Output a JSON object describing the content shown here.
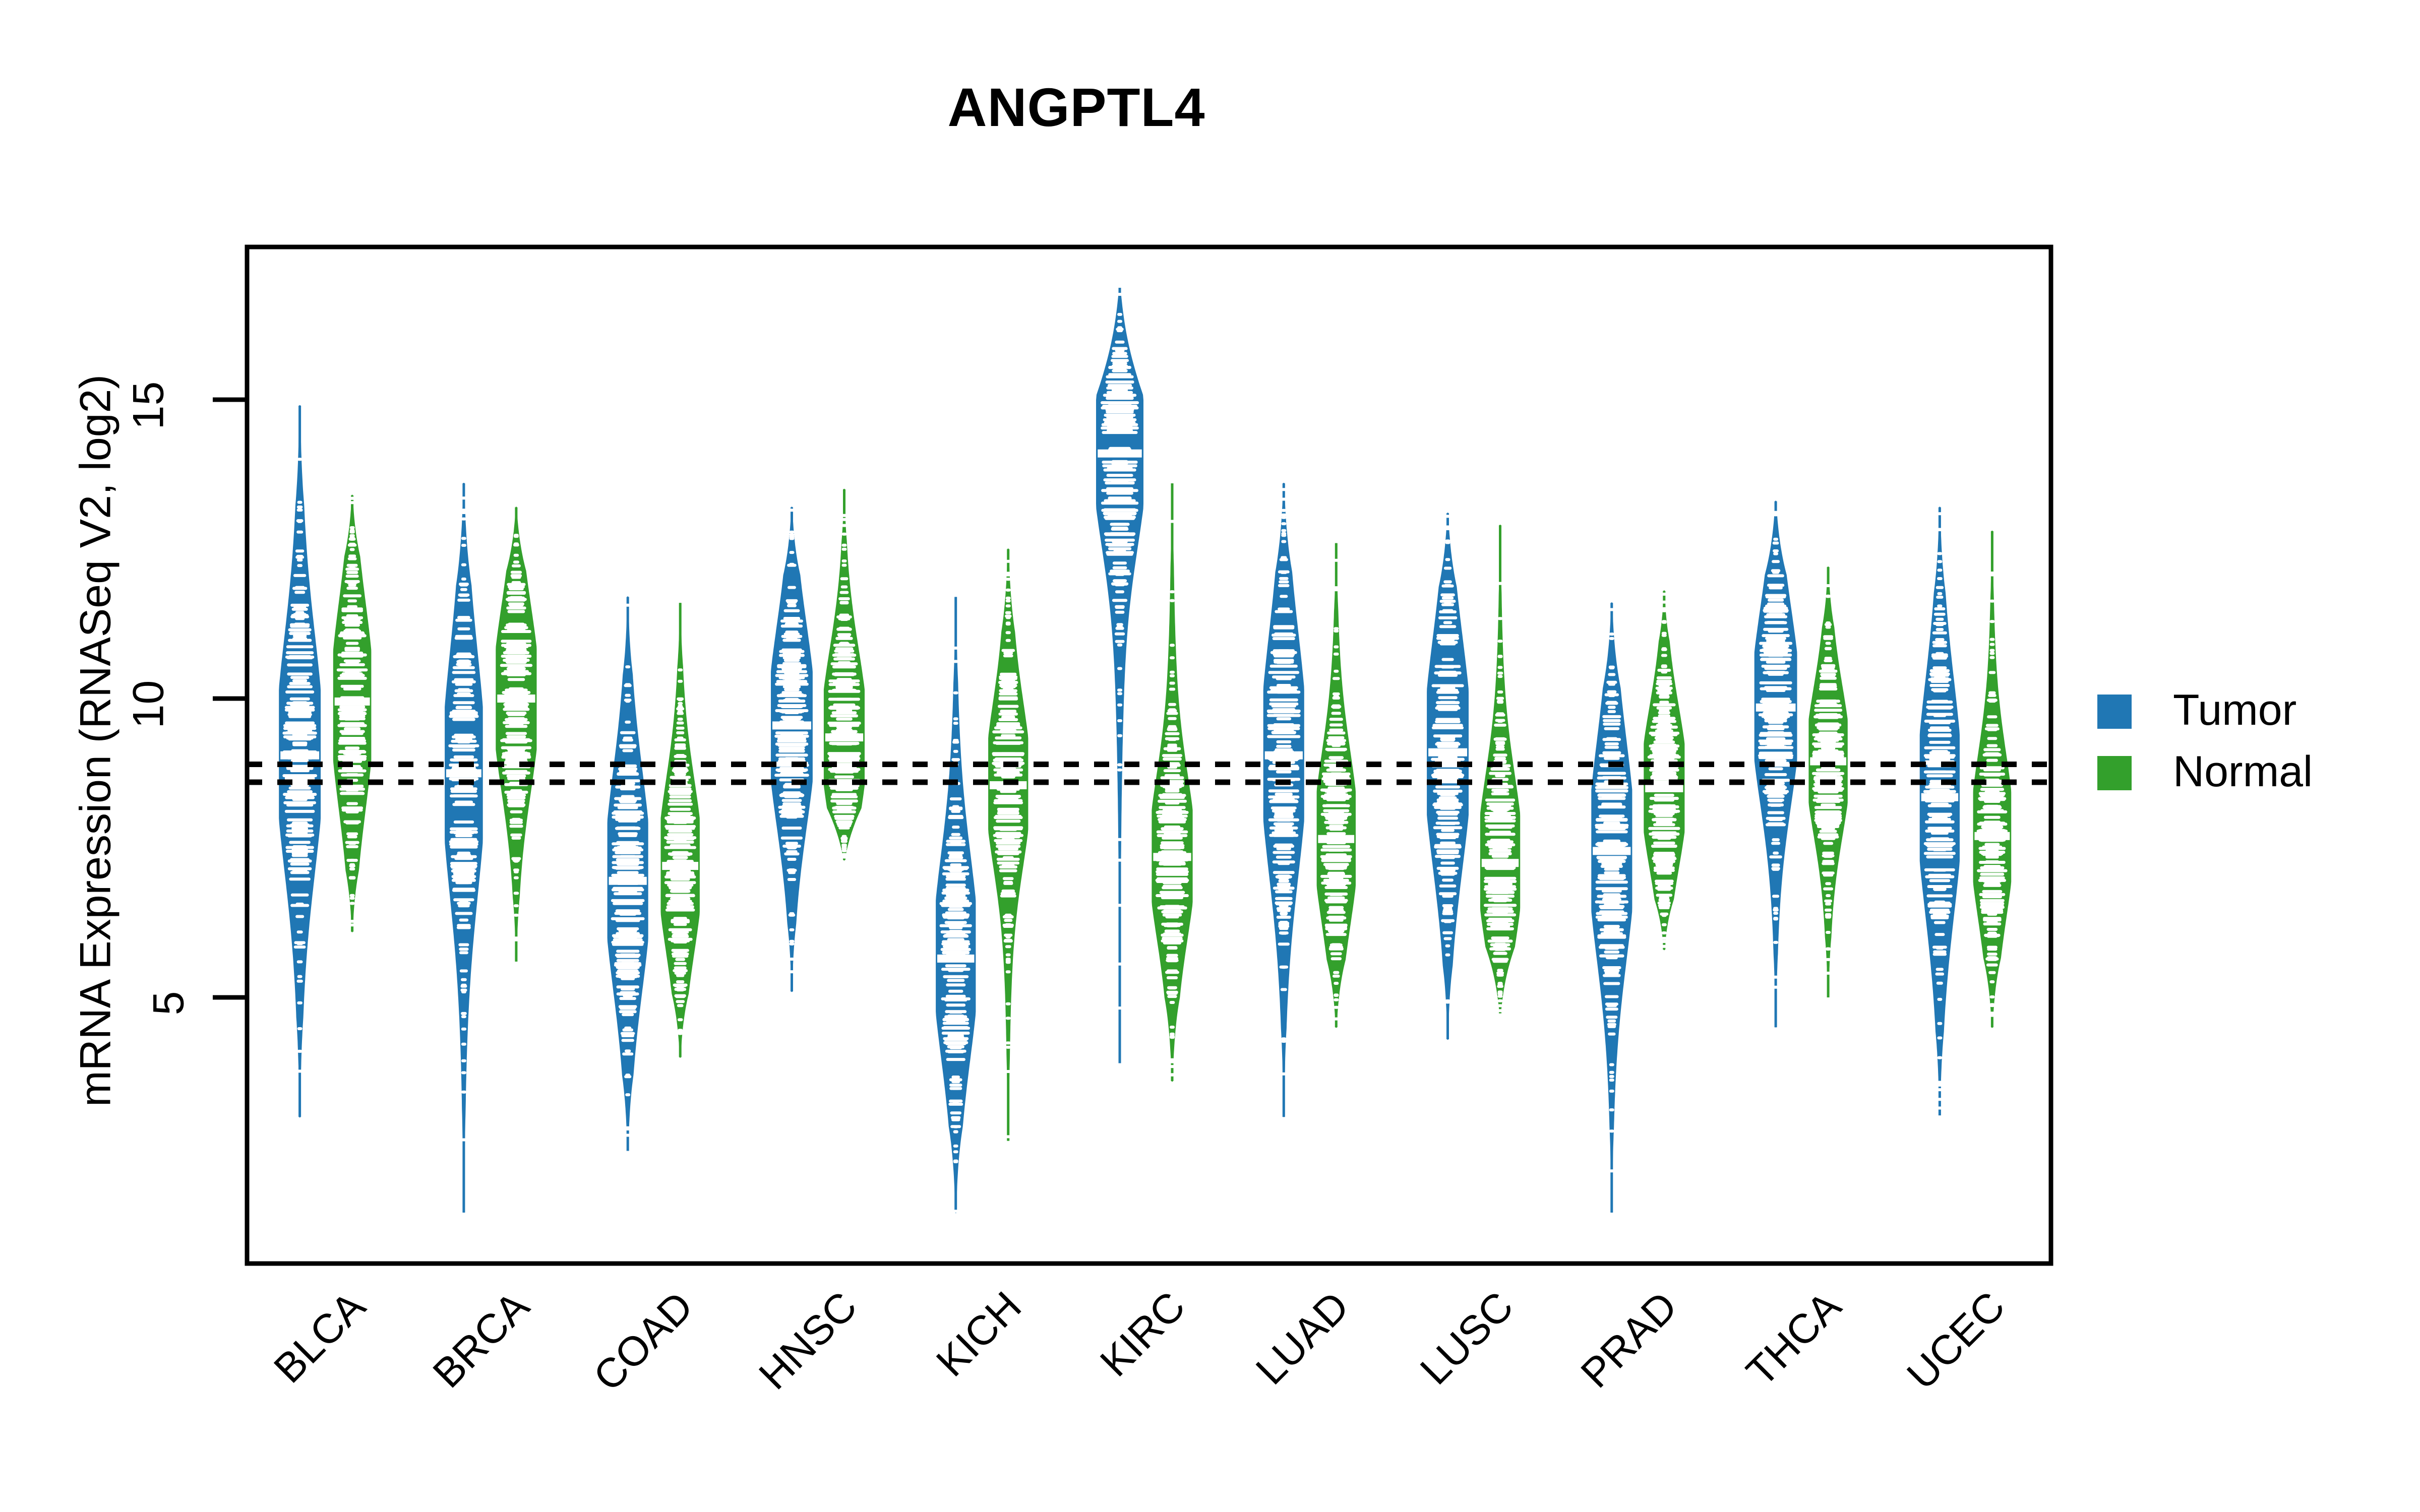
{
  "chart_data": {
    "type": "violin",
    "title": "ANGPTL4",
    "xlabel": "",
    "ylabel": "mRNA Expression (RNASeq V2, log2)",
    "ylim": [
      1.2,
      17.2
    ],
    "yticks": [
      5,
      10,
      15
    ],
    "ytick_labels": [
      "5",
      "10",
      "15"
    ],
    "grid": false,
    "legend_position": "right",
    "categories": [
      "BLCA",
      "BRCA",
      "COAD",
      "HNSC",
      "KICH",
      "KIRC",
      "LUAD",
      "LUSC",
      "PRAD",
      "THCA",
      "UCEC"
    ],
    "reference_lines": [
      {
        "value": 8.9,
        "style": "dotted",
        "color": "#000000"
      },
      {
        "value": 8.6,
        "style": "dotted",
        "color": "#000000"
      }
    ],
    "series": [
      {
        "name": "Tumor",
        "color": "#2077b4",
        "groups": [
          {
            "category": "BLCA",
            "median": 9.05,
            "q1": 7.9,
            "q3": 10.5,
            "min": 3.0,
            "max": 14.9,
            "width": 0.88
          },
          {
            "category": "BRCA",
            "median": 8.75,
            "q1": 7.3,
            "q3": 10.0,
            "min": 1.4,
            "max": 13.6,
            "width": 0.8
          },
          {
            "category": "COAD",
            "median": 6.95,
            "q1": 5.8,
            "q3": 8.2,
            "min": 2.4,
            "max": 11.7,
            "width": 0.86
          },
          {
            "category": "HNSC",
            "median": 9.55,
            "q1": 8.4,
            "q3": 10.6,
            "min": 5.1,
            "max": 13.2,
            "width": 0.88
          },
          {
            "category": "KICH",
            "median": 5.65,
            "q1": 4.8,
            "q3": 7.0,
            "min": 1.4,
            "max": 11.7,
            "width": 0.84
          },
          {
            "category": "KIRC",
            "median": 14.1,
            "q1": 13.2,
            "q3": 15.2,
            "min": 3.9,
            "max": 16.9,
            "width": 1.0
          },
          {
            "category": "LUAD",
            "median": 9.05,
            "q1": 7.8,
            "q3": 10.5,
            "min": 3.0,
            "max": 13.6,
            "width": 0.86
          },
          {
            "category": "LUSC",
            "median": 9.1,
            "q1": 7.8,
            "q3": 10.4,
            "min": 4.3,
            "max": 13.1,
            "width": 0.88
          },
          {
            "category": "PRAD",
            "median": 7.45,
            "q1": 6.3,
            "q3": 8.7,
            "min": 1.4,
            "max": 11.6,
            "width": 0.86
          },
          {
            "category": "THCA",
            "median": 9.85,
            "q1": 8.9,
            "q3": 11.0,
            "min": 4.5,
            "max": 13.3,
            "width": 0.9
          },
          {
            "category": "UCEC",
            "median": 8.35,
            "q1": 7.0,
            "q3": 9.6,
            "min": 3.0,
            "max": 13.2,
            "width": 0.84
          }
        ]
      },
      {
        "name": "Normal",
        "color": "#33a02c",
        "groups": [
          {
            "category": "BLCA",
            "median": 9.95,
            "q1": 8.5,
            "q3": 10.8,
            "min": 6.1,
            "max": 13.4,
            "width": 0.8
          },
          {
            "category": "BRCA",
            "median": 10.0,
            "q1": 9.0,
            "q3": 11.0,
            "min": 5.6,
            "max": 13.2,
            "width": 0.86
          },
          {
            "category": "COAD",
            "median": 7.2,
            "q1": 6.3,
            "q3": 8.1,
            "min": 4.0,
            "max": 11.6,
            "width": 0.82
          },
          {
            "category": "HNSC",
            "median": 9.35,
            "q1": 8.4,
            "q3": 10.3,
            "min": 7.3,
            "max": 13.5,
            "width": 0.86
          },
          {
            "category": "KICH",
            "median": 8.55,
            "q1": 7.9,
            "q3": 9.6,
            "min": 2.6,
            "max": 12.5,
            "width": 0.84
          },
          {
            "category": "KIRC",
            "median": 7.35,
            "q1": 6.6,
            "q3": 8.3,
            "min": 3.6,
            "max": 13.6,
            "width": 0.86
          },
          {
            "category": "LUAD",
            "median": 7.65,
            "q1": 6.8,
            "q3": 8.6,
            "min": 4.5,
            "max": 12.6,
            "width": 0.82
          },
          {
            "category": "LUSC",
            "median": 7.25,
            "q1": 6.5,
            "q3": 8.3,
            "min": 4.7,
            "max": 12.9,
            "width": 0.84
          },
          {
            "category": "PRAD",
            "median": 8.5,
            "q1": 7.7,
            "q3": 9.4,
            "min": 5.8,
            "max": 11.8,
            "width": 0.86
          },
          {
            "category": "THCA",
            "median": 8.95,
            "q1": 8.2,
            "q3": 9.7,
            "min": 5.0,
            "max": 12.2,
            "width": 0.82
          },
          {
            "category": "UCEC",
            "median": 7.7,
            "q1": 6.8,
            "q3": 8.5,
            "min": 4.5,
            "max": 12.8,
            "width": 0.8
          }
        ]
      }
    ]
  },
  "legend": {
    "items": [
      {
        "label": "Tumor",
        "color": "#2077b4"
      },
      {
        "label": "Normal",
        "color": "#33a02c"
      }
    ]
  },
  "axis": {
    "ylabel_text": "mRNA Expression (RNASeq V2, log2)",
    "ytick_0": "5",
    "ytick_1": "10",
    "ytick_2": "15"
  },
  "xticks": {
    "t0": "BLCA",
    "t1": "BRCA",
    "t2": "COAD",
    "t3": "HNSC",
    "t4": "KICH",
    "t5": "KIRC",
    "t6": "LUAD",
    "t7": "LUSC",
    "t8": "PRAD",
    "t9": "THCA",
    "t10": "UCEC"
  },
  "title": {
    "text": "ANGPTL4"
  }
}
